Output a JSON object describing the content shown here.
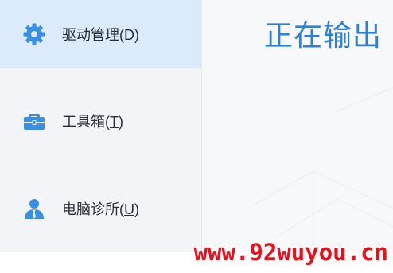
{
  "sidebar": {
    "items": [
      {
        "label": "驱动管理(",
        "key": "D",
        "suffix": ")",
        "icon": "gear-icon",
        "active": true
      },
      {
        "label": "工具箱(",
        "key": "T",
        "suffix": ")",
        "icon": "toolbox-icon",
        "active": false
      },
      {
        "label": "电脑诊所(",
        "key": "U",
        "suffix": ")",
        "icon": "user-icon",
        "active": false
      }
    ]
  },
  "main": {
    "title": "正在输出"
  },
  "watermark": {
    "text": "www.92wuyou.cn"
  },
  "colors": {
    "accent": "#2f7fd4",
    "icon_blue": "#3a8ee6",
    "active_bg": "#dcebfb",
    "sidebar_bg": "#f2f4f7",
    "watermark_red": "#e8101a"
  }
}
